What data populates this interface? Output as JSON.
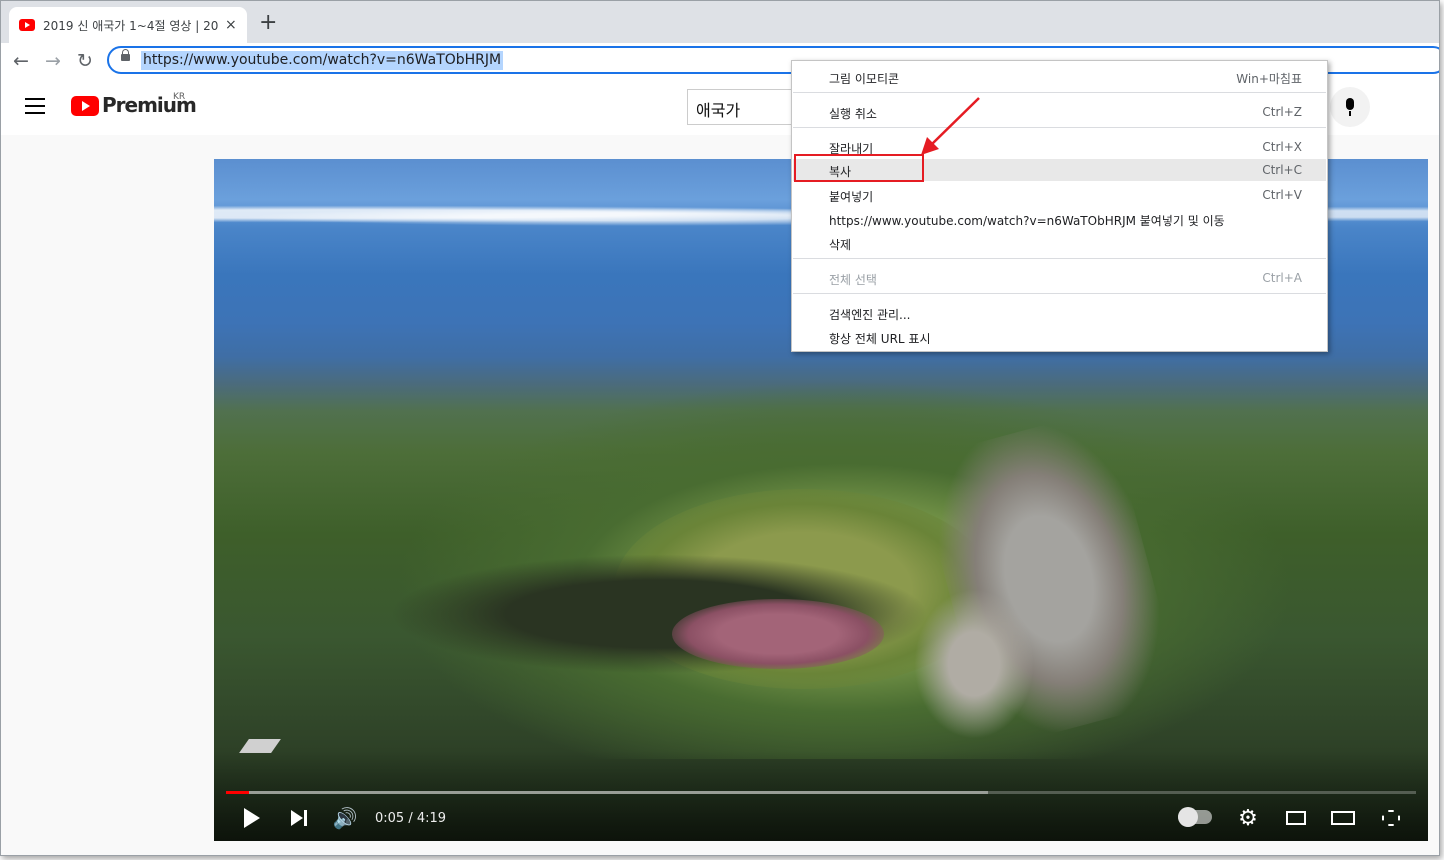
{
  "browser": {
    "tab_title": "2019 신 애국가 1~4절 영상 | 20",
    "tab_close": "×",
    "new_tab": "+",
    "back": "←",
    "forward": "→",
    "reload": "↻",
    "url": "https://www.youtube.com/watch?v=n6WaTObHRJM"
  },
  "youtube": {
    "brand": "Premium",
    "region": "KR",
    "search_value": "애국가"
  },
  "player": {
    "current_time": "0:05",
    "duration": "4:19",
    "time_display": "0:05 / 4:19",
    "progress_fraction": 0.019,
    "buffer_fraction": 0.64,
    "volume_glyph": "🔊",
    "settings_glyph": "⚙"
  },
  "context_menu": {
    "items": [
      {
        "label": "그림 이모티콘",
        "shortcut": "Win+마침표",
        "disabled": false
      },
      {
        "label": "실행 취소",
        "shortcut": "Ctrl+Z",
        "disabled": false
      },
      {
        "label": "잘라내기",
        "shortcut": "Ctrl+X",
        "disabled": false
      },
      {
        "label": "복사",
        "shortcut": "Ctrl+C",
        "disabled": false
      },
      {
        "label": "붙여넣기",
        "shortcut": "Ctrl+V",
        "disabled": false
      },
      {
        "label": "https://www.youtube.com/watch?v=n6WaTObHRJM 붙여넣기 및 이동",
        "shortcut": "",
        "disabled": false
      },
      {
        "label": "삭제",
        "shortcut": "",
        "disabled": false
      },
      {
        "label": "전체 선택",
        "shortcut": "Ctrl+A",
        "disabled": true
      },
      {
        "label": "검색엔진 관리...",
        "shortcut": "",
        "disabled": false
      },
      {
        "label": "항상 전체 URL 표시",
        "shortcut": "",
        "disabled": false
      }
    ]
  },
  "colors": {
    "accent": "#1a73e8",
    "annotation": "#e51c23",
    "youtube_red": "#ff0000"
  }
}
